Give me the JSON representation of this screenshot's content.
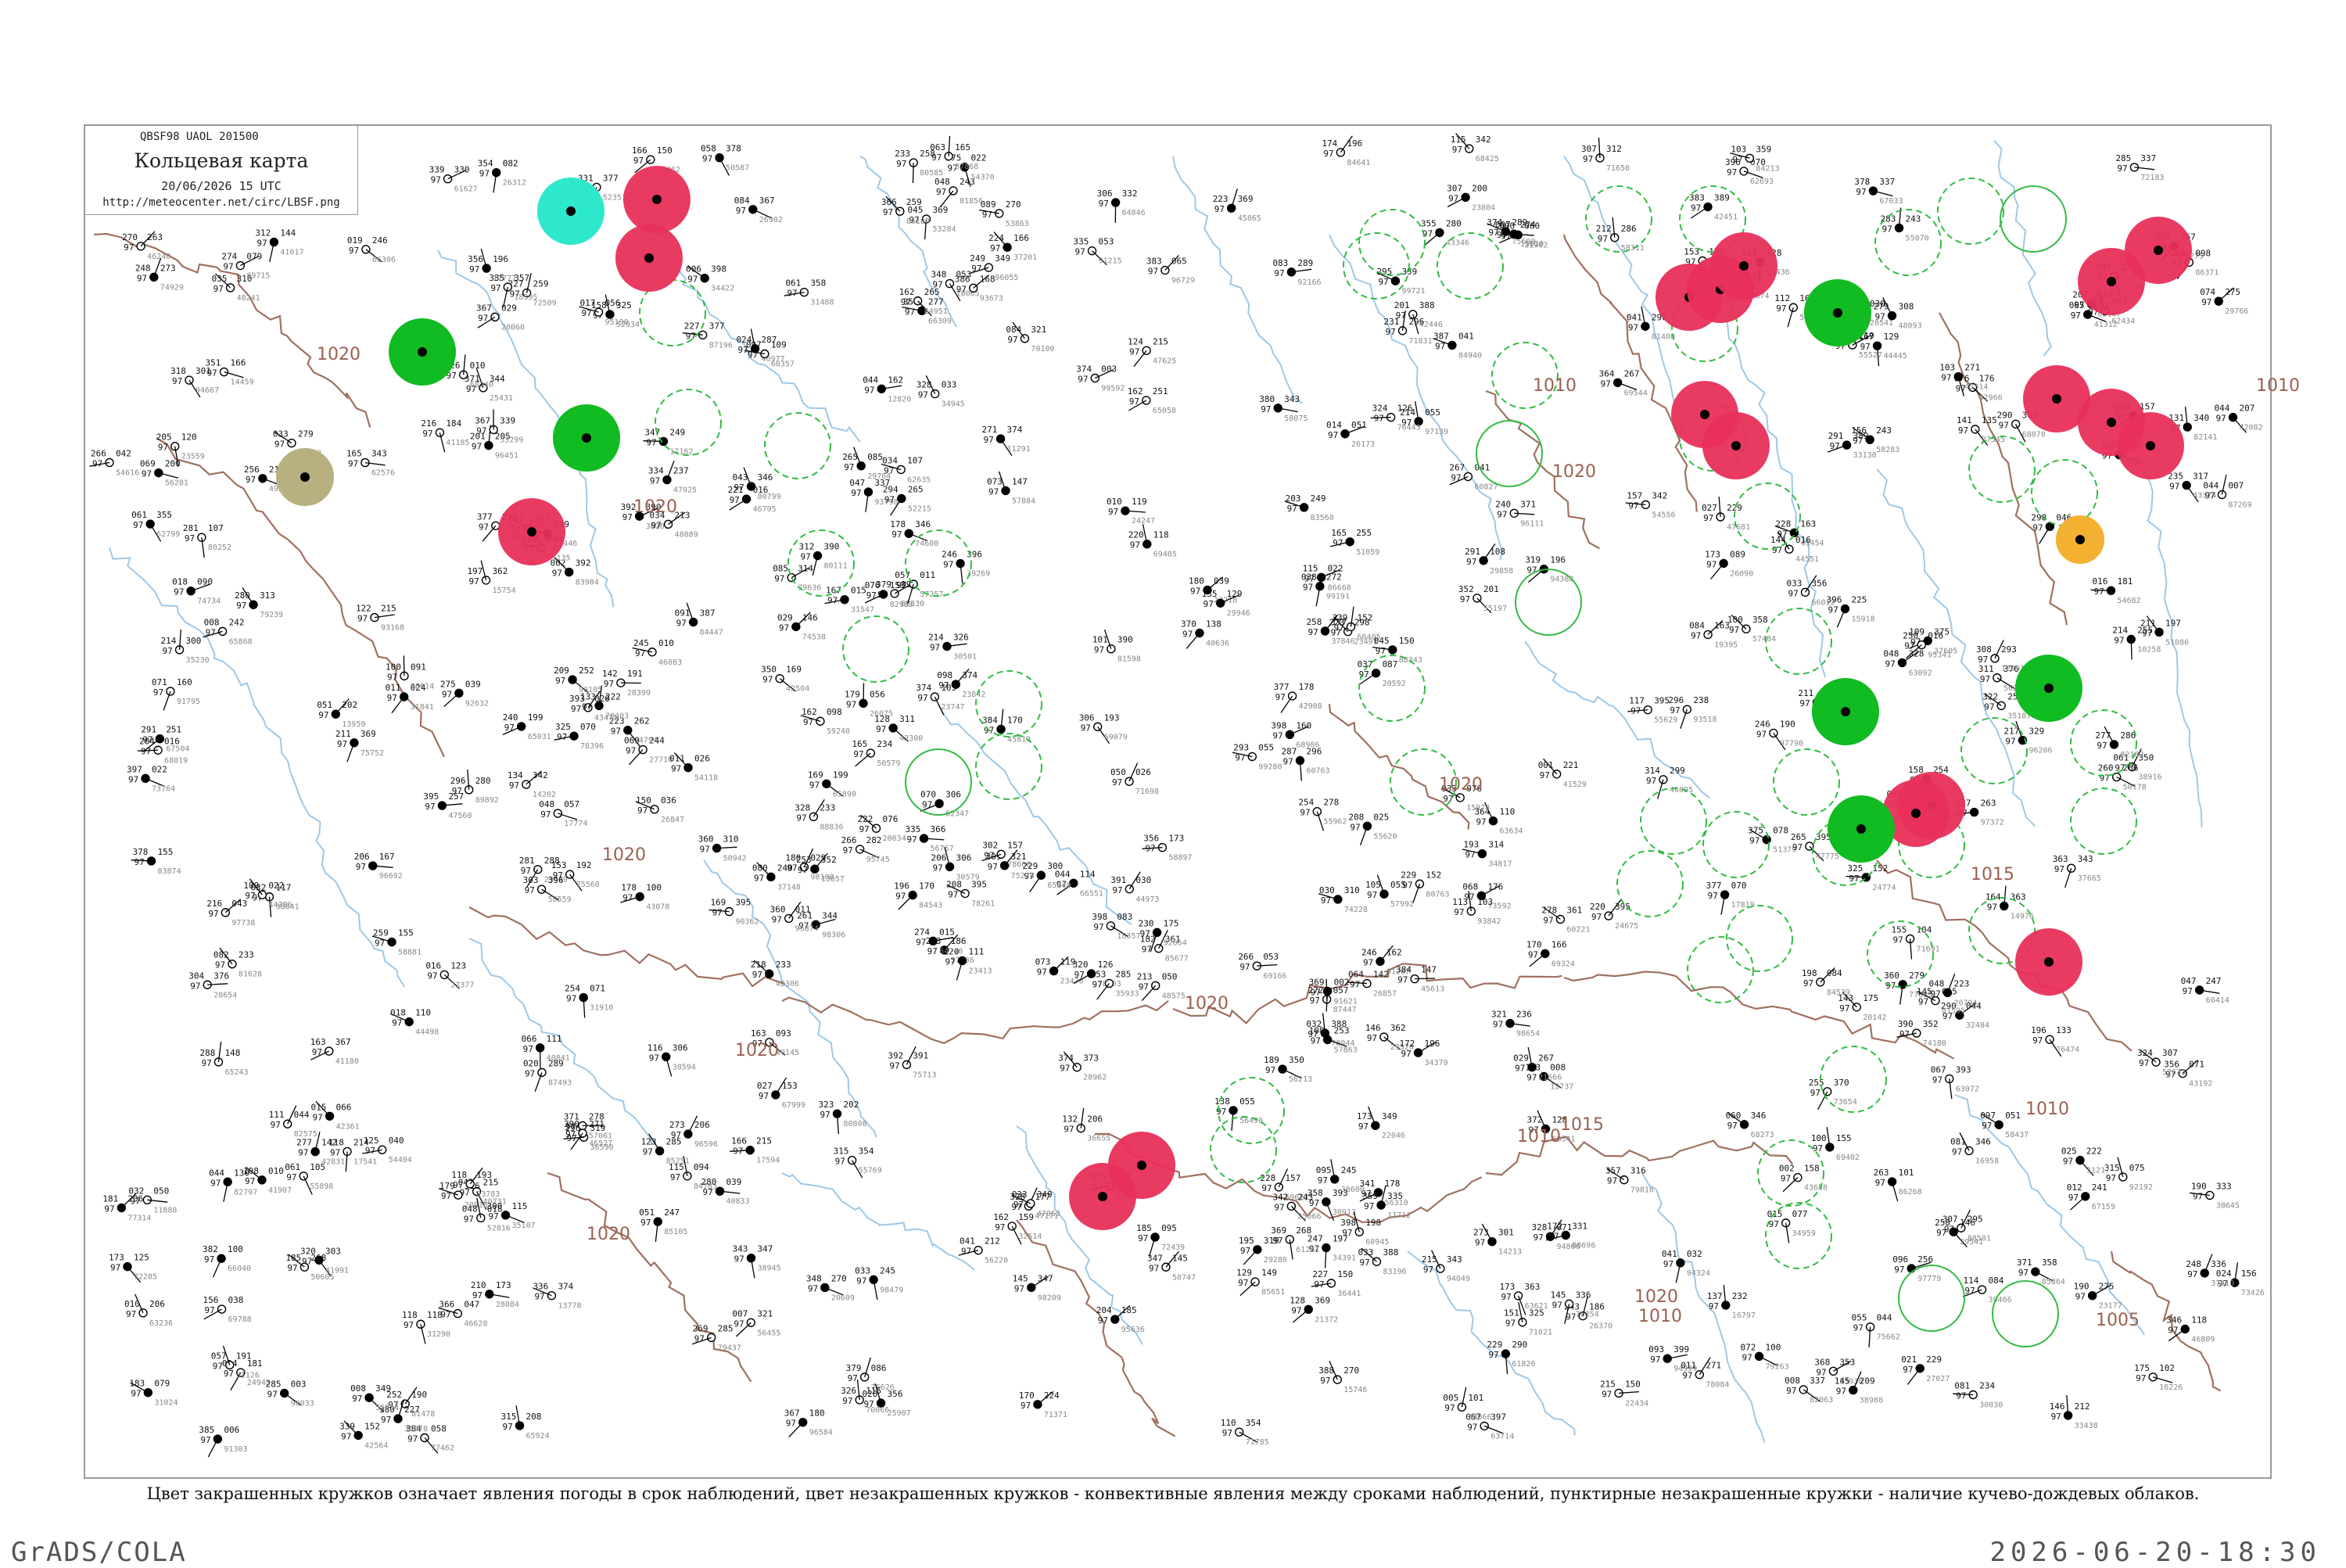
{
  "legend": {
    "codes": "QBSF98  UAOL  201500",
    "title": "Кольцевая карта",
    "date": "20/06/2026 15 UTC",
    "url": "http://meteocenter.net/circ/LBSF.png"
  },
  "caption": "Цвет закрашенных кружков означает явления погоды в срок наблюдений, цвет незакрашенных кружков - конвективные явления между сроками наблюдений, пунктирные незакрашенные кружки - наличие кучево-дождевых облаков.",
  "footer": {
    "left": "GrADS/COLA",
    "right": "2026-06-20-18:30"
  },
  "colors": {
    "frame": "#9a9a9a",
    "coast": "#9ec8e8",
    "border": "#a07060",
    "isobar_label": "#9a6050",
    "thunder": "#e8305a",
    "rain": "#11bb22",
    "cb_dashed": "#33bb44",
    "fog": "#2ee8cc",
    "haze": "#b8b080",
    "dust": "#f4b030"
  },
  "isobars": [
    {
      "label": "1020"
    },
    {
      "label": "1020"
    },
    {
      "label": "1020"
    },
    {
      "label": "1020"
    },
    {
      "label": "1020"
    },
    {
      "label": "1020"
    },
    {
      "label": "1020"
    },
    {
      "label": "1020"
    },
    {
      "label": "1020"
    },
    {
      "label": "1010"
    },
    {
      "label": "1010"
    },
    {
      "label": "1015"
    },
    {
      "label": "1010"
    },
    {
      "label": "1015"
    },
    {
      "label": "1005"
    },
    {
      "label": "1010"
    },
    {
      "label": "1010"
    }
  ],
  "filled_circles": [
    {
      "kind": "thunder",
      "n": 1
    },
    {
      "kind": "thunder",
      "n": 2
    },
    {
      "kind": "thunder",
      "n": 3
    },
    {
      "kind": "thunder",
      "n": 4
    },
    {
      "kind": "thunder",
      "n": 5
    },
    {
      "kind": "thunder",
      "n": 6
    },
    {
      "kind": "thunder",
      "n": 7
    },
    {
      "kind": "thunder",
      "n": 8
    },
    {
      "kind": "thunder",
      "n": 9
    },
    {
      "kind": "thunder",
      "n": 10
    },
    {
      "kind": "thunder",
      "n": 11
    },
    {
      "kind": "thunder",
      "n": 12
    },
    {
      "kind": "thunder",
      "n": 13
    },
    {
      "kind": "thunder",
      "n": 14
    },
    {
      "kind": "thunder",
      "n": 15
    },
    {
      "kind": "thunder",
      "n": 16
    },
    {
      "kind": "thunder",
      "n": 17
    },
    {
      "kind": "thunder",
      "n": 18
    },
    {
      "kind": "rain",
      "n": 1
    },
    {
      "kind": "rain",
      "n": 2
    },
    {
      "kind": "rain",
      "n": 3
    },
    {
      "kind": "rain",
      "n": 4
    },
    {
      "kind": "rain",
      "n": 5
    },
    {
      "kind": "rain",
      "n": 6
    },
    {
      "kind": "fog",
      "n": 1
    },
    {
      "kind": "haze",
      "n": 1
    },
    {
      "kind": "dust",
      "n": 1
    }
  ]
}
